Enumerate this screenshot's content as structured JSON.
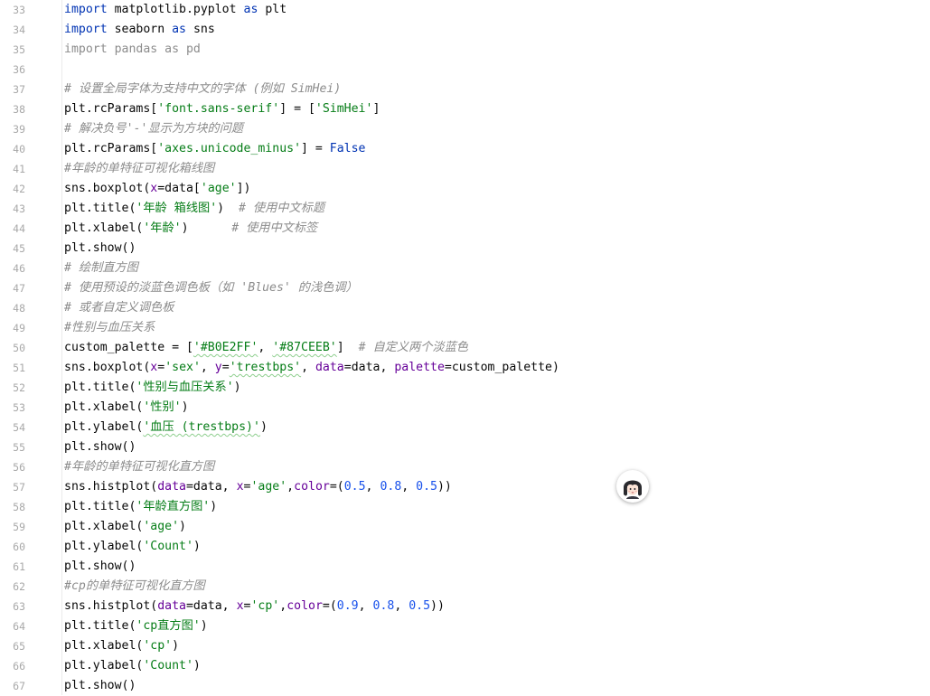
{
  "editor": {
    "lines": [
      {
        "num": "33",
        "tokens": [
          {
            "t": "import",
            "c": "keyword"
          },
          {
            "t": " matplotlib.pyplot ",
            "c": "plain"
          },
          {
            "t": "as",
            "c": "keyword"
          },
          {
            "t": " plt",
            "c": "plain"
          }
        ]
      },
      {
        "num": "34",
        "tokens": [
          {
            "t": "import",
            "c": "keyword"
          },
          {
            "t": " seaborn ",
            "c": "plain"
          },
          {
            "t": "as",
            "c": "keyword"
          },
          {
            "t": " sns",
            "c": "plain"
          }
        ]
      },
      {
        "num": "35",
        "tokens": [
          {
            "t": "import pandas as pd",
            "c": "unused"
          }
        ]
      },
      {
        "num": "36",
        "tokens": []
      },
      {
        "num": "37",
        "tokens": [
          {
            "t": "# 设置全局字体为支持中文的字体 (例如 SimHei)",
            "c": "comment"
          }
        ]
      },
      {
        "num": "38",
        "tokens": [
          {
            "t": "plt.rcParams[",
            "c": "plain"
          },
          {
            "t": "'font.sans-serif'",
            "c": "string"
          },
          {
            "t": "] = [",
            "c": "plain"
          },
          {
            "t": "'SimHei'",
            "c": "string"
          },
          {
            "t": "]",
            "c": "plain"
          }
        ]
      },
      {
        "num": "39",
        "tokens": [
          {
            "t": "# 解决负号'-'显示为方块的问题",
            "c": "comment"
          }
        ]
      },
      {
        "num": "40",
        "tokens": [
          {
            "t": "plt.rcParams[",
            "c": "plain"
          },
          {
            "t": "'axes.unicode_minus'",
            "c": "string"
          },
          {
            "t": "] = ",
            "c": "plain"
          },
          {
            "t": "False",
            "c": "keyword"
          }
        ]
      },
      {
        "num": "41",
        "tokens": [
          {
            "t": "#年龄的单特征可视化箱线图",
            "c": "comment"
          }
        ]
      },
      {
        "num": "42",
        "tokens": [
          {
            "t": "sns.boxplot(",
            "c": "plain"
          },
          {
            "t": "x",
            "c": "param"
          },
          {
            "t": "=data[",
            "c": "plain"
          },
          {
            "t": "'age'",
            "c": "string"
          },
          {
            "t": "])",
            "c": "plain"
          }
        ]
      },
      {
        "num": "43",
        "tokens": [
          {
            "t": "plt.title(",
            "c": "plain"
          },
          {
            "t": "'年龄 箱线图'",
            "c": "string"
          },
          {
            "t": ")  ",
            "c": "plain"
          },
          {
            "t": "# 使用中文标题",
            "c": "comment"
          }
        ]
      },
      {
        "num": "44",
        "tokens": [
          {
            "t": "plt.xlabel(",
            "c": "plain"
          },
          {
            "t": "'年龄'",
            "c": "string"
          },
          {
            "t": ")      ",
            "c": "plain"
          },
          {
            "t": "# 使用中文标签",
            "c": "comment"
          }
        ]
      },
      {
        "num": "45",
        "tokens": [
          {
            "t": "plt.show()",
            "c": "plain"
          }
        ]
      },
      {
        "num": "46",
        "tokens": [
          {
            "t": "# 绘制直方图",
            "c": "comment"
          }
        ]
      },
      {
        "num": "47",
        "tokens": [
          {
            "t": "# 使用预设的淡蓝色调色板（如 'Blues' 的浅色调）",
            "c": "comment"
          }
        ]
      },
      {
        "num": "48",
        "tokens": [
          {
            "t": "# 或者自定义调色板",
            "c": "comment"
          }
        ]
      },
      {
        "num": "49",
        "tokens": [
          {
            "t": "#性别与血压关系",
            "c": "comment"
          }
        ]
      },
      {
        "num": "50",
        "tokens": [
          {
            "t": "custom_palette = [",
            "c": "plain"
          },
          {
            "t": "'#B0E2FF'",
            "c": "string"
          },
          {
            "t": ", ",
            "c": "plain"
          },
          {
            "t": "'#87CEEB'",
            "c": "string"
          },
          {
            "t": "]  ",
            "c": "plain"
          },
          {
            "t": "# 自定义两个淡蓝色",
            "c": "comment"
          }
        ]
      },
      {
        "num": "51",
        "tokens": [
          {
            "t": "sns.boxplot(",
            "c": "plain"
          },
          {
            "t": "x",
            "c": "param"
          },
          {
            "t": "=",
            "c": "plain"
          },
          {
            "t": "'sex'",
            "c": "string"
          },
          {
            "t": ", ",
            "c": "plain"
          },
          {
            "t": "y",
            "c": "param"
          },
          {
            "t": "=",
            "c": "plain"
          },
          {
            "t": "'trestbps'",
            "c": "string"
          },
          {
            "t": ", ",
            "c": "plain"
          },
          {
            "t": "data",
            "c": "param"
          },
          {
            "t": "=data, ",
            "c": "plain"
          },
          {
            "t": "palette",
            "c": "param"
          },
          {
            "t": "=custom_palette)",
            "c": "plain"
          }
        ]
      },
      {
        "num": "52",
        "tokens": [
          {
            "t": "plt.title(",
            "c": "plain"
          },
          {
            "t": "'性别与血压关系'",
            "c": "string"
          },
          {
            "t": ")",
            "c": "plain"
          }
        ]
      },
      {
        "num": "53",
        "tokens": [
          {
            "t": "plt.xlabel(",
            "c": "plain"
          },
          {
            "t": "'性别'",
            "c": "string"
          },
          {
            "t": ")",
            "c": "plain"
          }
        ]
      },
      {
        "num": "54",
        "tokens": [
          {
            "t": "plt.ylabel(",
            "c": "plain"
          },
          {
            "t": "'血压 (trestbps)'",
            "c": "string"
          },
          {
            "t": ")",
            "c": "plain"
          }
        ]
      },
      {
        "num": "55",
        "tokens": [
          {
            "t": "plt.show()",
            "c": "plain"
          }
        ]
      },
      {
        "num": "56",
        "tokens": [
          {
            "t": "#年龄的单特征可视化直方图",
            "c": "comment"
          }
        ]
      },
      {
        "num": "57",
        "tokens": [
          {
            "t": "sns.histplot(",
            "c": "plain"
          },
          {
            "t": "data",
            "c": "param"
          },
          {
            "t": "=data, ",
            "c": "plain"
          },
          {
            "t": "x",
            "c": "param"
          },
          {
            "t": "=",
            "c": "plain"
          },
          {
            "t": "'age'",
            "c": "string"
          },
          {
            "t": ",",
            "c": "plain"
          },
          {
            "t": "color",
            "c": "param"
          },
          {
            "t": "=(",
            "c": "plain"
          },
          {
            "t": "0.5",
            "c": "number"
          },
          {
            "t": ", ",
            "c": "plain"
          },
          {
            "t": "0.8",
            "c": "number"
          },
          {
            "t": ", ",
            "c": "plain"
          },
          {
            "t": "0.5",
            "c": "number"
          },
          {
            "t": "))",
            "c": "plain"
          }
        ]
      },
      {
        "num": "58",
        "tokens": [
          {
            "t": "plt.title(",
            "c": "plain"
          },
          {
            "t": "'年龄直方图'",
            "c": "string"
          },
          {
            "t": ")",
            "c": "plain"
          }
        ]
      },
      {
        "num": "59",
        "tokens": [
          {
            "t": "plt.xlabel(",
            "c": "plain"
          },
          {
            "t": "'age'",
            "c": "string"
          },
          {
            "t": ")",
            "c": "plain"
          }
        ]
      },
      {
        "num": "60",
        "tokens": [
          {
            "t": "plt.ylabel(",
            "c": "plain"
          },
          {
            "t": "'Count'",
            "c": "string"
          },
          {
            "t": ")",
            "c": "plain"
          }
        ]
      },
      {
        "num": "61",
        "tokens": [
          {
            "t": "plt.show()",
            "c": "plain"
          }
        ]
      },
      {
        "num": "62",
        "tokens": [
          {
            "t": "#cp的单特征可视化直方图",
            "c": "comment"
          }
        ]
      },
      {
        "num": "63",
        "tokens": [
          {
            "t": "sns.histplot(",
            "c": "plain"
          },
          {
            "t": "data",
            "c": "param"
          },
          {
            "t": "=data, ",
            "c": "plain"
          },
          {
            "t": "x",
            "c": "param"
          },
          {
            "t": "=",
            "c": "plain"
          },
          {
            "t": "'cp'",
            "c": "string"
          },
          {
            "t": ",",
            "c": "plain"
          },
          {
            "t": "color",
            "c": "param"
          },
          {
            "t": "=(",
            "c": "plain"
          },
          {
            "t": "0.9",
            "c": "number"
          },
          {
            "t": ", ",
            "c": "plain"
          },
          {
            "t": "0.8",
            "c": "number"
          },
          {
            "t": ", ",
            "c": "plain"
          },
          {
            "t": "0.5",
            "c": "number"
          },
          {
            "t": "))",
            "c": "plain"
          }
        ]
      },
      {
        "num": "64",
        "tokens": [
          {
            "t": "plt.title(",
            "c": "plain"
          },
          {
            "t": "'cp直方图'",
            "c": "string"
          },
          {
            "t": ")",
            "c": "plain"
          }
        ]
      },
      {
        "num": "65",
        "tokens": [
          {
            "t": "plt.xlabel(",
            "c": "plain"
          },
          {
            "t": "'cp'",
            "c": "string"
          },
          {
            "t": ")",
            "c": "plain"
          }
        ]
      },
      {
        "num": "66",
        "tokens": [
          {
            "t": "plt.ylabel(",
            "c": "plain"
          },
          {
            "t": "'Count'",
            "c": "string"
          },
          {
            "t": ")",
            "c": "plain"
          }
        ]
      },
      {
        "num": "67",
        "tokens": [
          {
            "t": "plt.show()",
            "c": "plain"
          }
        ]
      }
    ],
    "typo_words": [
      "trestbps",
      "B0E2FF",
      "87CEEB"
    ]
  },
  "assistant": {
    "icon": "assistant-avatar-icon"
  },
  "colors": {
    "keyword": "#0033b3",
    "string": "#067d17",
    "number": "#1750eb",
    "param": "#660099",
    "comment": "#8c8c8c",
    "plain": "#080808",
    "line_number": "#a8a8a8"
  }
}
